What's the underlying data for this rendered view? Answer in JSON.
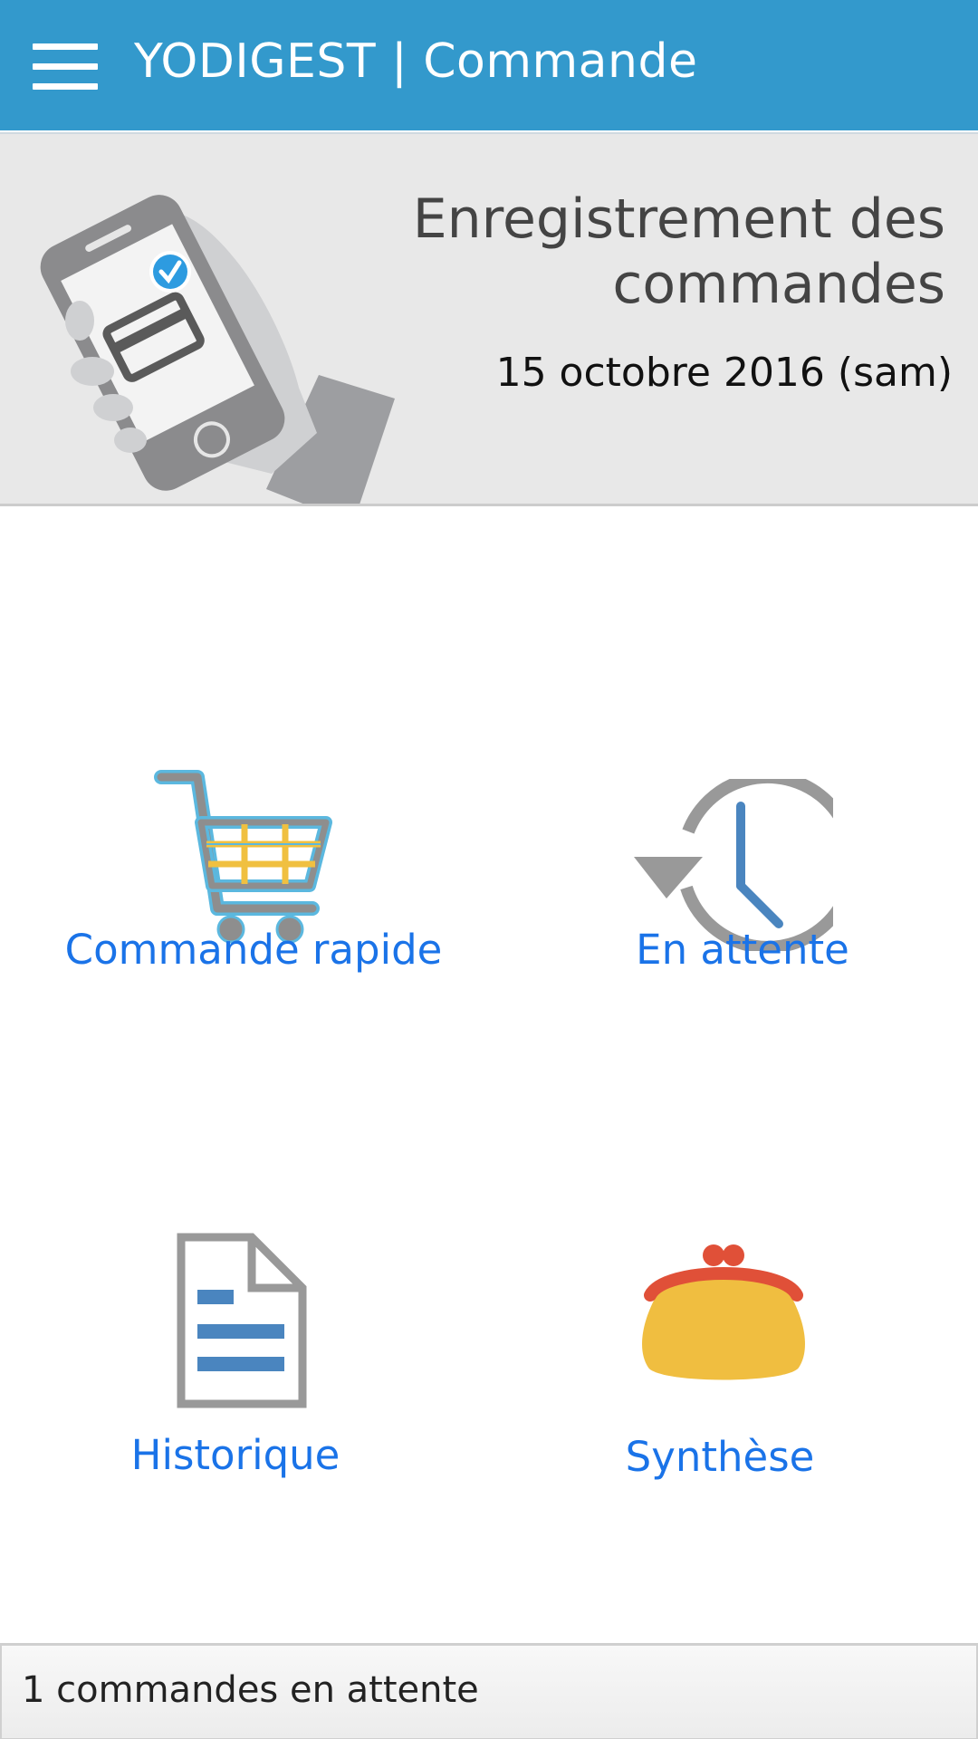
{
  "app_bar": {
    "title": "YODIGEST | Commande"
  },
  "banner": {
    "title_line1": "Enregistrement des",
    "title_line2": "commandes",
    "date": "15 octobre 2016 (sam)"
  },
  "actions": [
    {
      "label": "Commande rapide",
      "icon": "shopping-cart-icon"
    },
    {
      "label": "En attente",
      "icon": "history-clock-icon"
    },
    {
      "label": "Historique",
      "icon": "document-icon"
    },
    {
      "label": "Synthèse",
      "icon": "purse-icon"
    }
  ],
  "footer": {
    "status": "1 commandes en attente"
  },
  "colors": {
    "app_bar": "#3399cc",
    "link": "#1a73e8",
    "banner_bg": "#e8e8e8"
  }
}
